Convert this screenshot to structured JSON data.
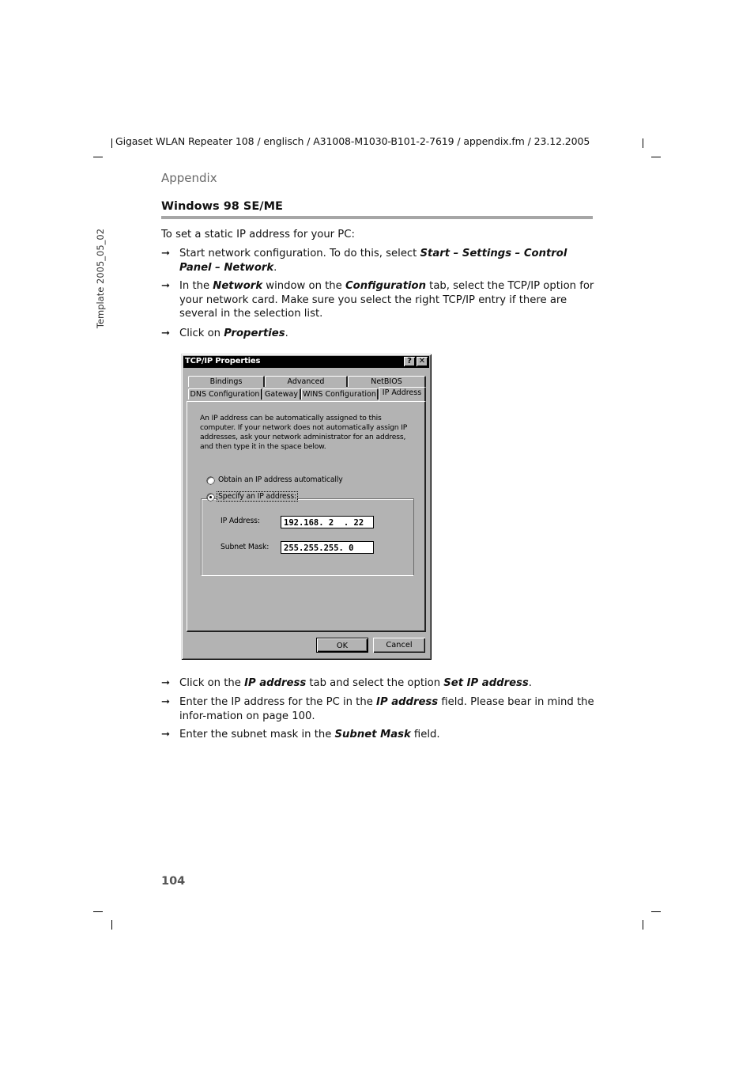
{
  "header": {
    "running_head": "Gigaset WLAN Repeater 108 / englisch / A31008-M1030-B101-2-7619 / appendix.fm / 23.12.2005",
    "side_label": "Template 2005_05_02"
  },
  "section": "Appendix",
  "title": "Windows 98 SE/ME",
  "intro": "To set a static IP address for your PC:",
  "steps_before": [
    {
      "parts": [
        {
          "t": "Start network configuration. To do this, select "
        },
        {
          "t": "Start – Settings – Control Panel – Network",
          "em": true
        },
        {
          "t": "."
        }
      ]
    },
    {
      "parts": [
        {
          "t": "In the "
        },
        {
          "t": "Network",
          "em": true
        },
        {
          "t": " window on the "
        },
        {
          "t": "Configuration",
          "em": true
        },
        {
          "t": " tab, select the TCP/IP option for your network card. Make sure you select the right TCP/IP entry if there are several in the selection list."
        }
      ]
    },
    {
      "parts": [
        {
          "t": "Click on "
        },
        {
          "t": "Properties",
          "em": true
        },
        {
          "t": "."
        }
      ]
    }
  ],
  "steps_after": [
    {
      "parts": [
        {
          "t": "Click on the "
        },
        {
          "t": "IP address",
          "em": true
        },
        {
          "t": " tab and select the option "
        },
        {
          "t": "Set IP address",
          "em": true
        },
        {
          "t": "."
        }
      ]
    },
    {
      "parts": [
        {
          "t": "Enter the IP address for the PC in the "
        },
        {
          "t": "IP address",
          "em": true
        },
        {
          "t": " field. Please bear in mind the infor-mation on page 100."
        }
      ]
    },
    {
      "parts": [
        {
          "t": "Enter the subnet mask in the "
        },
        {
          "t": "Subnet Mask",
          "em": true
        },
        {
          "t": " field."
        }
      ]
    }
  ],
  "arrow_glyph": "➞",
  "dialog": {
    "title": "TCP/IP Properties",
    "help_button": "?",
    "close_button": "✕",
    "tabs_row1": [
      "Bindings",
      "Advanced",
      "NetBIOS"
    ],
    "tabs_row2": [
      "DNS Configuration",
      "Gateway",
      "WINS Configuration",
      "IP Address"
    ],
    "active_tab": "IP Address",
    "description": "An IP address can be automatically assigned to this computer. If your network does not automatically assign IP addresses, ask your network administrator for an address, and then type it in the space below.",
    "radio_auto": "Obtain an IP address automatically",
    "radio_specify": "Specify an IP address:",
    "selected_option": "Specify an IP address:",
    "ip_label": "IP Address:",
    "ip_value": "192.168. 2  . 22",
    "subnet_label": "Subnet Mask:",
    "subnet_value": "255.255.255. 0",
    "ok_label": "OK",
    "cancel_label": "Cancel"
  },
  "page_number": "104"
}
